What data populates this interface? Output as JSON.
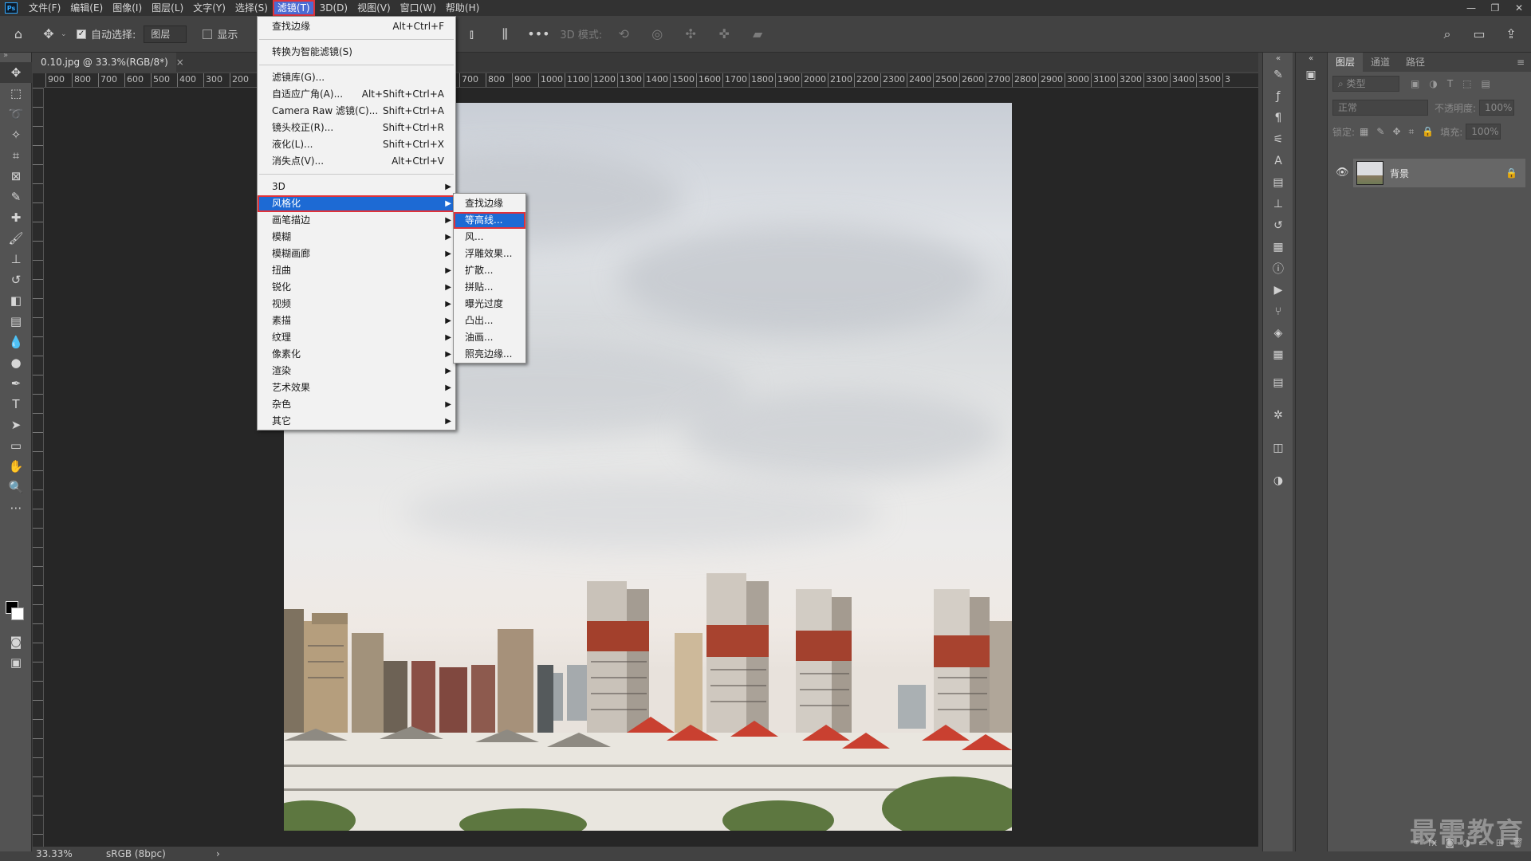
{
  "menubar": {
    "logo": "Ps",
    "items": [
      "文件(F)",
      "编辑(E)",
      "图像(I)",
      "图层(L)",
      "文字(Y)",
      "选择(S)",
      "滤镜(T)",
      "3D(D)",
      "视图(V)",
      "窗口(W)",
      "帮助(H)"
    ],
    "active_index": 6
  },
  "window_controls": [
    "—",
    "❐",
    "✕"
  ],
  "options": {
    "auto_select_label": "自动选择:",
    "target_value": "图层",
    "show_label": "显示",
    "mode_3d_label": "3D 模式:"
  },
  "document": {
    "tab_title": "0.10.jpg @ 33.3%(RGB/8*)",
    "close": "×"
  },
  "ruler_h": [
    "900",
    "800",
    "700",
    "600",
    "500",
    "400",
    "300",
    "200",
    "700",
    "800",
    "900",
    "1000",
    "1100",
    "1200",
    "1300",
    "1400",
    "1500",
    "1600",
    "1700",
    "1800",
    "1900",
    "2000",
    "2100",
    "2200",
    "2300",
    "2400",
    "2500",
    "2600",
    "2700",
    "2800",
    "2900",
    "3000",
    "3100",
    "3200",
    "3300",
    "3400",
    "3500",
    "3"
  ],
  "status": {
    "zoom": "33.33%",
    "profile": "sRGB (8bpc)",
    "arrow": "›"
  },
  "filter_menu": {
    "items": [
      {
        "label": "查找边缘",
        "shortcut": "Alt+Ctrl+F"
      },
      {
        "sep": true
      },
      {
        "label": "转换为智能滤镜(S)",
        "shortcut": ""
      },
      {
        "sep": true
      },
      {
        "label": "滤镜库(G)...",
        "shortcut": ""
      },
      {
        "label": "自适应广角(A)...",
        "shortcut": "Alt+Shift+Ctrl+A"
      },
      {
        "label": "Camera Raw 滤镜(C)...",
        "shortcut": "Shift+Ctrl+A"
      },
      {
        "label": "镜头校正(R)...",
        "shortcut": "Shift+Ctrl+R"
      },
      {
        "label": "液化(L)...",
        "shortcut": "Shift+Ctrl+X"
      },
      {
        "label": "消失点(V)...",
        "shortcut": "Alt+Ctrl+V"
      },
      {
        "sep": true
      },
      {
        "label": "3D",
        "sub": true
      },
      {
        "label": "风格化",
        "sub": true,
        "hl": true
      },
      {
        "label": "画笔描边",
        "sub": true
      },
      {
        "label": "模糊",
        "sub": true
      },
      {
        "label": "模糊画廊",
        "sub": true
      },
      {
        "label": "扭曲",
        "sub": true
      },
      {
        "label": "锐化",
        "sub": true
      },
      {
        "label": "视频",
        "sub": true
      },
      {
        "label": "素描",
        "sub": true
      },
      {
        "label": "纹理",
        "sub": true
      },
      {
        "label": "像素化",
        "sub": true
      },
      {
        "label": "渲染",
        "sub": true
      },
      {
        "label": "艺术效果",
        "sub": true
      },
      {
        "label": "杂色",
        "sub": true
      },
      {
        "label": "其它",
        "sub": true
      }
    ]
  },
  "stylize_menu": {
    "items": [
      {
        "label": "查找边缘"
      },
      {
        "label": "等高线...",
        "hl": true
      },
      {
        "label": "风..."
      },
      {
        "label": "浮雕效果..."
      },
      {
        "label": "扩散..."
      },
      {
        "label": "拼贴..."
      },
      {
        "label": "曝光过度"
      },
      {
        "label": "凸出..."
      },
      {
        "label": "油画..."
      },
      {
        "label": "照亮边缘..."
      }
    ]
  },
  "layers_panel": {
    "tabs": [
      "图层",
      "通道",
      "路径"
    ],
    "filter_placeholder": "类型",
    "blend_mode": "正常",
    "opacity_label": "不透明度:",
    "opacity_value": "100%",
    "lock_label": "锁定:",
    "fill_label": "填充:",
    "fill_value": "100%",
    "layer_name": "背景"
  },
  "watermark": "最需教育"
}
